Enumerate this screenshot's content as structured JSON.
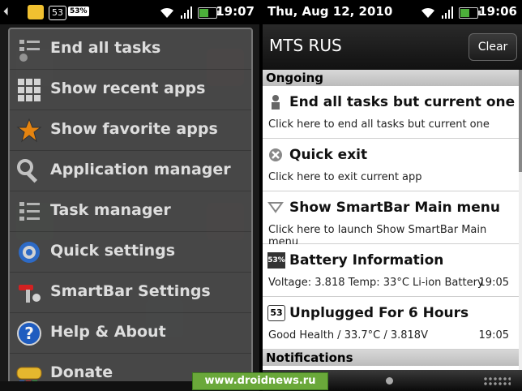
{
  "left_phone": {
    "status": {
      "time": "19:07",
      "battery_badge": "53",
      "battery_text": "53%",
      "battery_level_fraction": 0.53
    },
    "menu": {
      "items": [
        {
          "label": "End all tasks",
          "icon": "list-icon"
        },
        {
          "label": "Show recent apps",
          "icon": "grid-icon"
        },
        {
          "label": "Show favorite apps",
          "icon": "star-icon"
        },
        {
          "label": "Application manager",
          "icon": "wrench-icon"
        },
        {
          "label": "Task manager",
          "icon": "list-icon"
        },
        {
          "label": "Quick settings",
          "icon": "gear-icon"
        },
        {
          "label": "SmartBar Settings",
          "icon": "tools-icon"
        },
        {
          "label": "Help & About",
          "icon": "help-icon"
        },
        {
          "label": "Donate",
          "icon": "donate-icon"
        }
      ]
    }
  },
  "right_phone": {
    "status": {
      "date": "Thu, Aug 12, 2010",
      "time": "19:06",
      "battery_level_fraction": 0.53
    },
    "header": {
      "carrier": "MTS RUS",
      "clear_label": "Clear"
    },
    "sections": {
      "ongoing": "Ongoing",
      "notifications": "Notifications"
    },
    "notifications": [
      {
        "title": "End all tasks but current one",
        "text": "Click here to end all tasks but current one",
        "time": "",
        "icon": "person-icon"
      },
      {
        "title": "Quick exit",
        "text": "Click here to exit current app",
        "time": "",
        "icon": "exit-icon"
      },
      {
        "title": "Show SmartBar Main menu",
        "text": "Click here to launch Show SmartBar Main menu",
        "time": "",
        "icon": "triangle-down-icon"
      },
      {
        "title": "Battery Information",
        "text": "Voltage: 3.818 Temp: 33°C Li-ion Battery",
        "time": "19:05",
        "icon": "battery-icon",
        "badge": "53%"
      },
      {
        "title": "Unplugged For 6 Hours",
        "text": "Good Health / 33.7°C / 3.818V",
        "time": "19:05",
        "icon": "battery-badge-icon",
        "badge": "53"
      }
    ]
  },
  "watermark": "www.droidnews.ru",
  "colors": {
    "menu_bg": "#4a4a4a",
    "notification_bg": "#ffffff",
    "battery_green": "#4caf3a",
    "watermark_green": "#6aa83a"
  }
}
